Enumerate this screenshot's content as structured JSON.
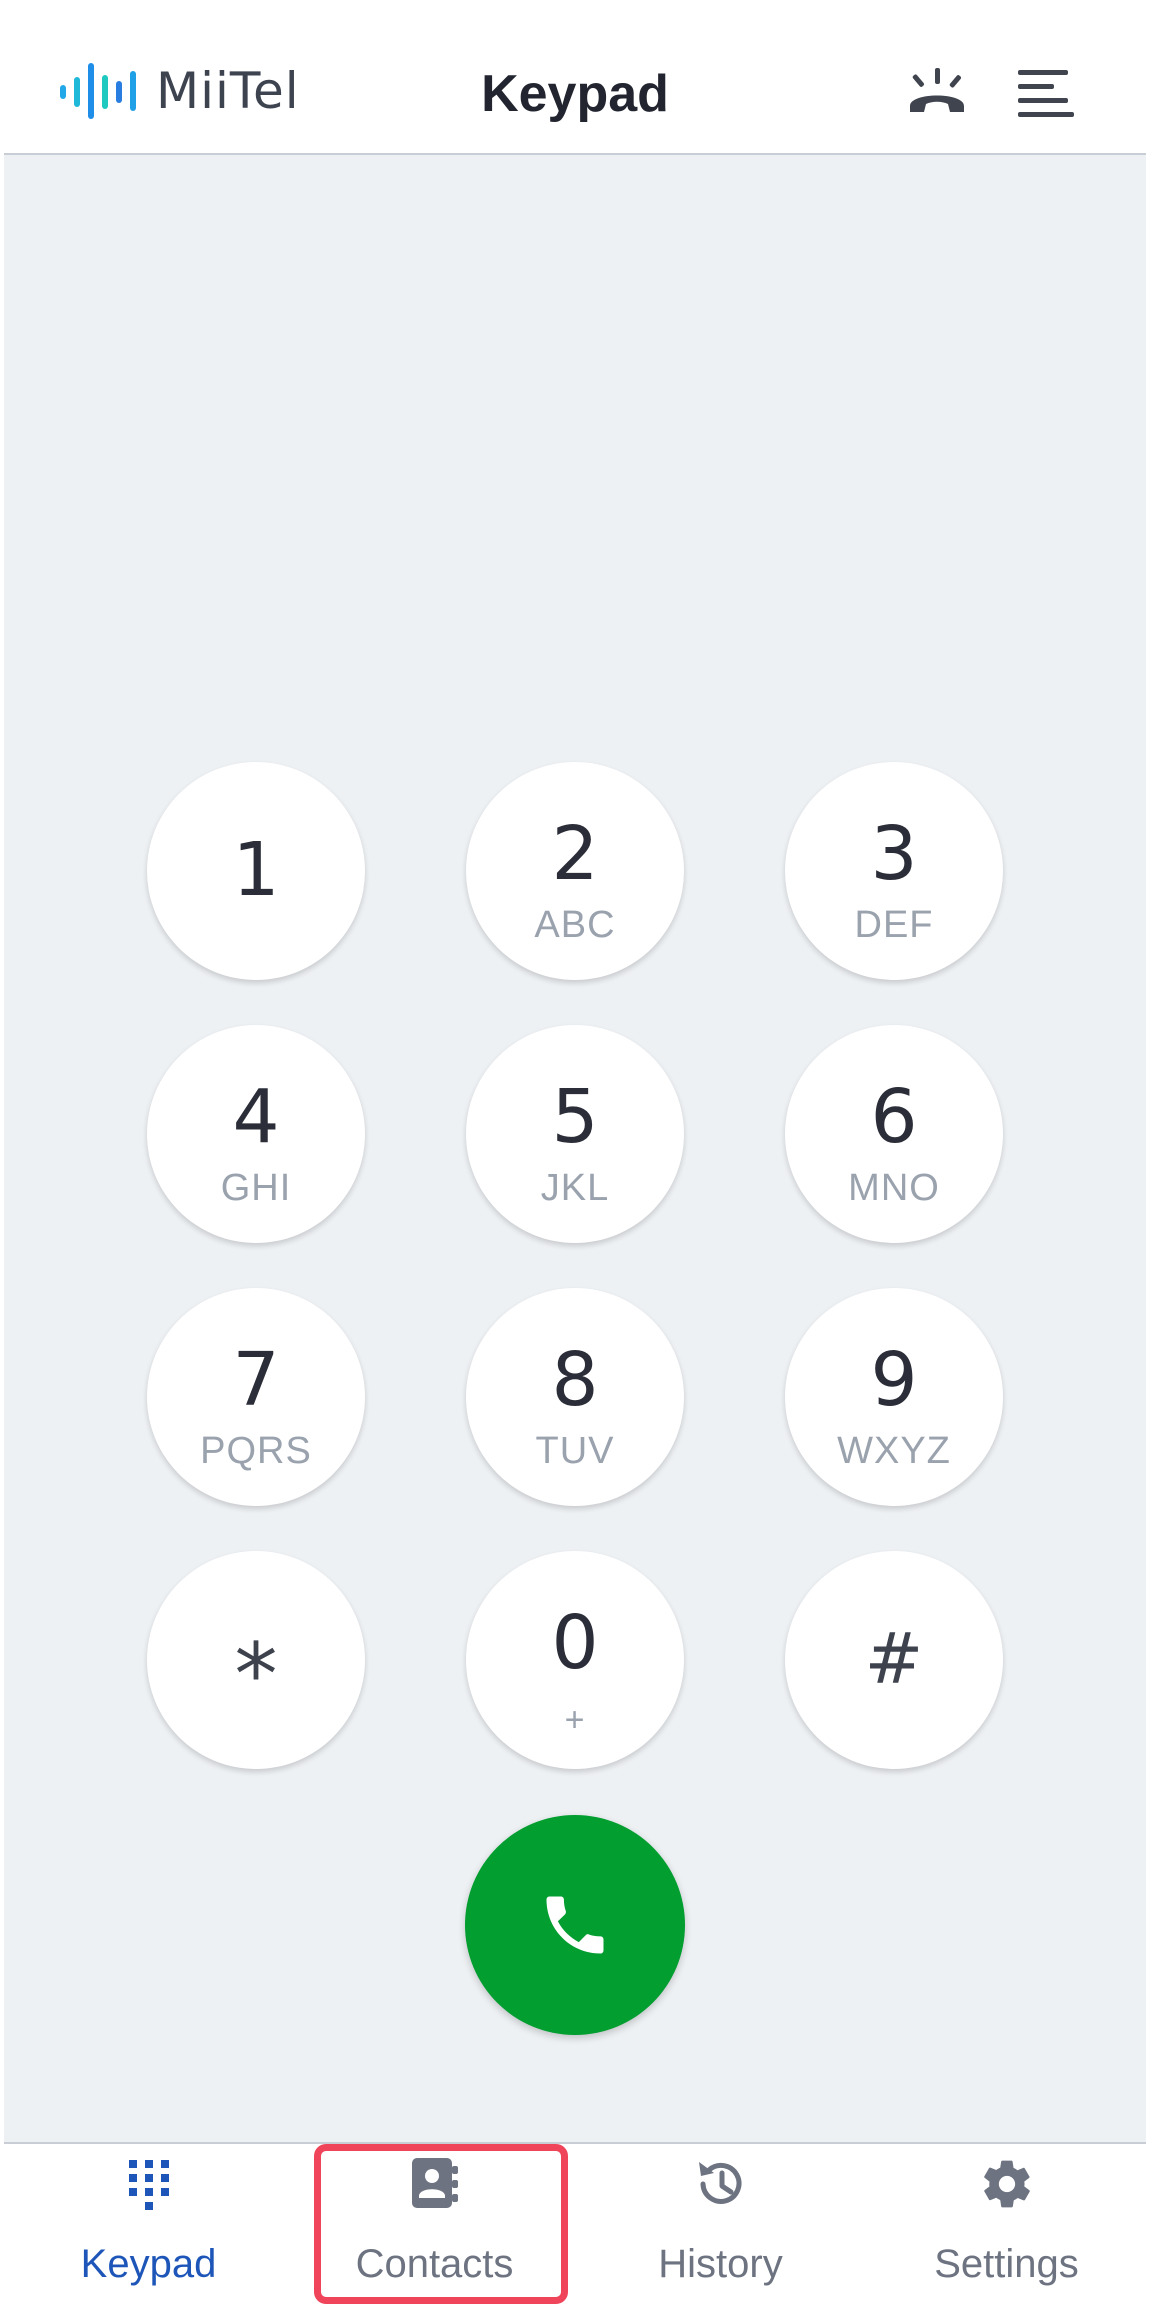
{
  "header": {
    "brand": "MiiTel",
    "title": "Keypad",
    "icons": [
      "ringing-phone-icon",
      "menu-icon"
    ],
    "accent": "#22a7e8"
  },
  "keypad": {
    "keys": [
      {
        "digit": "1",
        "letters": ""
      },
      {
        "digit": "2",
        "letters": "ABC"
      },
      {
        "digit": "3",
        "letters": "DEF"
      },
      {
        "digit": "4",
        "letters": "GHI"
      },
      {
        "digit": "5",
        "letters": "JKL"
      },
      {
        "digit": "6",
        "letters": "MNO"
      },
      {
        "digit": "7",
        "letters": "PQRS"
      },
      {
        "digit": "8",
        "letters": "TUV"
      },
      {
        "digit": "9",
        "letters": "WXYZ"
      },
      {
        "digit": "*",
        "letters": ""
      },
      {
        "digit": "0",
        "letters": "+"
      },
      {
        "digit": "#",
        "letters": ""
      }
    ],
    "call_color": "#029e2f"
  },
  "nav": {
    "items": [
      {
        "label": "Keypad",
        "icon": "dialpad-icon",
        "active": true
      },
      {
        "label": "Contacts",
        "icon": "contacts-book-icon",
        "active": false
      },
      {
        "label": "History",
        "icon": "history-icon",
        "active": false
      },
      {
        "label": "Settings",
        "icon": "gear-icon",
        "active": false
      }
    ],
    "active_color": "#1d56b8",
    "highlight_color": "#f0445b"
  }
}
